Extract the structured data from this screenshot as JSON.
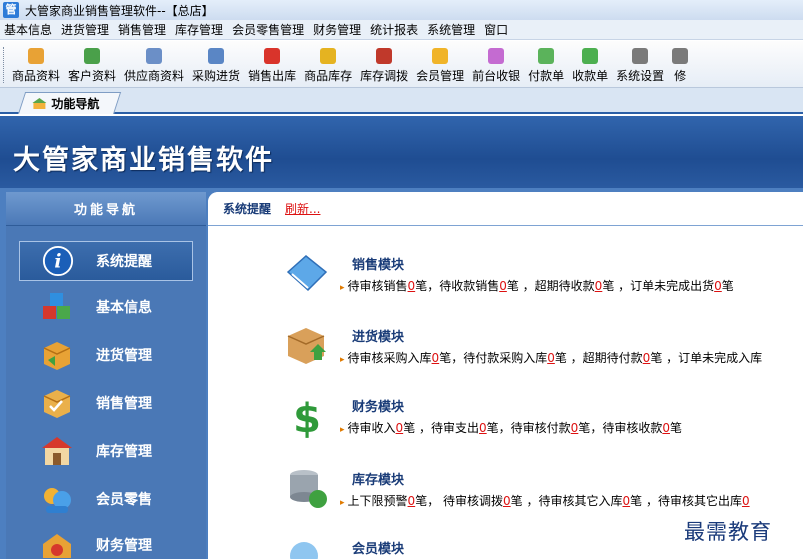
{
  "window": {
    "title": "大管家商业销售管理软件--【总店】",
    "icon_char": "管"
  },
  "menu": [
    "基本信息",
    "进货管理",
    "销售管理",
    "库存管理",
    "会员零售管理",
    "财务管理",
    "统计报表",
    "系统管理",
    "窗口"
  ],
  "toolbar": [
    {
      "label": "商品资料",
      "icon": "goods-icon",
      "color": "#e8a235"
    },
    {
      "label": "客户资料",
      "icon": "customer-icon",
      "color": "#4aa04a"
    },
    {
      "label": "供应商资料",
      "icon": "supplier-icon",
      "color": "#6b8fc7"
    },
    {
      "label": "采购进货",
      "icon": "purchase-icon",
      "color": "#5a86c5"
    },
    {
      "label": "销售出库",
      "icon": "sales-out-icon",
      "color": "#d9342b"
    },
    {
      "label": "商品库存",
      "icon": "stock-icon",
      "color": "#e5b321"
    },
    {
      "label": "库存调拨",
      "icon": "transfer-icon",
      "color": "#c0392b"
    },
    {
      "label": "会员管理",
      "icon": "member-icon",
      "color": "#f0b429"
    },
    {
      "label": "前台收银",
      "icon": "cashier-icon",
      "color": "#c46bd1"
    },
    {
      "label": "付款单",
      "icon": "payment-icon",
      "color": "#5bb35b"
    },
    {
      "label": "收款单",
      "icon": "receipt-icon",
      "color": "#4caf50"
    },
    {
      "label": "系统设置",
      "icon": "settings-icon",
      "color": "#7a7a7a"
    },
    {
      "label": "修",
      "icon": "edit-icon",
      "color": "#7a7a7a"
    }
  ],
  "tab": {
    "label": "功能导航"
  },
  "banner": {
    "title": "大管家商业销售软件"
  },
  "sidebar": {
    "header": "功能导航",
    "items": [
      {
        "label": "系统提醒",
        "icon": "info-icon",
        "active": true
      },
      {
        "label": "基本信息",
        "icon": "cubes-icon",
        "active": false
      },
      {
        "label": "进货管理",
        "icon": "purchase-box-icon",
        "active": false
      },
      {
        "label": "销售管理",
        "icon": "sales-box-icon",
        "active": false
      },
      {
        "label": "库存管理",
        "icon": "warehouse-icon",
        "active": false
      },
      {
        "label": "会员零售",
        "icon": "members-icon",
        "active": false
      },
      {
        "label": "财务管理",
        "icon": "finance-icon",
        "active": false
      }
    ]
  },
  "content": {
    "header_title": "系统提醒",
    "refresh_label": "刷新...",
    "modules": [
      {
        "title": "销售模块",
        "icon": "sales-module-icon",
        "parts": [
          "待审核销售",
          "0",
          "笔，待收款销售",
          "0",
          "笔 ，超期待收款",
          "0",
          "笔 ，订单未完成出货",
          "0",
          "笔"
        ]
      },
      {
        "title": "进货模块",
        "icon": "purchase-module-icon",
        "parts": [
          "待审核采购入库",
          "0",
          "笔，待付款采购入库",
          "0",
          "笔 ，超期待付款",
          "0",
          "笔 ，订单未完成入库",
          "",
          ""
        ]
      },
      {
        "title": "财务模块",
        "icon": "finance-module-icon",
        "parts": [
          "待审收入",
          "0",
          "笔 ，待审支出",
          "0",
          "笔，待审核付款",
          "0",
          "笔，待审核收款",
          "0",
          "笔"
        ]
      },
      {
        "title": "库存模块",
        "icon": "stock-module-icon",
        "parts": [
          "上下限预警",
          "0",
          "笔， 待审核调拨",
          "0",
          "笔 ，待审核其它入库",
          "0",
          "笔 ，待审核其它出库",
          "0",
          ""
        ]
      },
      {
        "title": "会员模块",
        "icon": "member-module-icon",
        "parts": []
      }
    ]
  },
  "watermark": "最需教育"
}
